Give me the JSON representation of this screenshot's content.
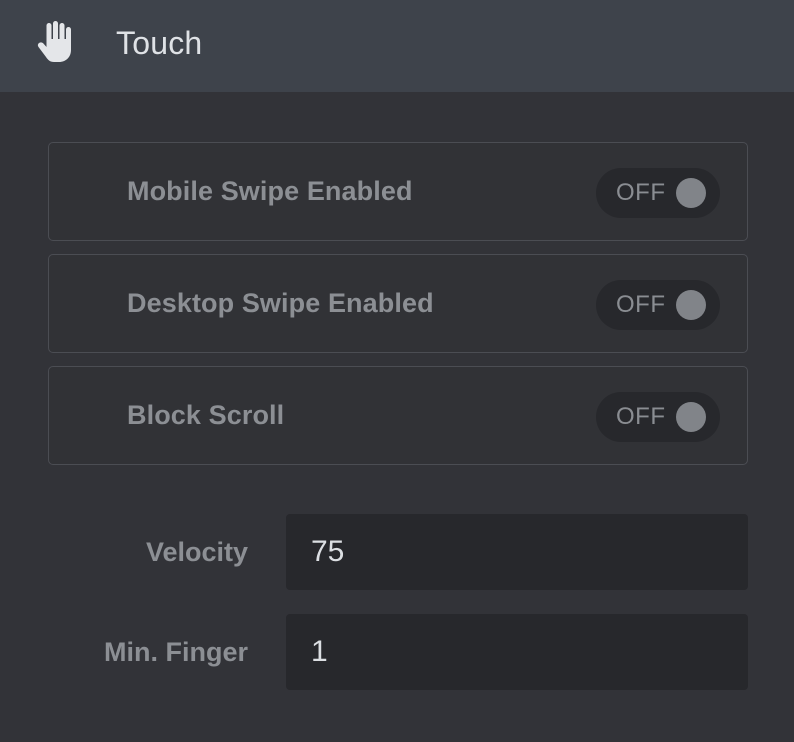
{
  "header": {
    "icon": "hand-icon",
    "title": "Touch"
  },
  "toggles": [
    {
      "label": "Mobile Swipe Enabled",
      "state": "OFF"
    },
    {
      "label": "Desktop Swipe Enabled",
      "state": "OFF"
    },
    {
      "label": "Block Scroll",
      "state": "OFF"
    }
  ],
  "fields": [
    {
      "label": "Velocity",
      "value": "75"
    },
    {
      "label": "Min. Finger",
      "value": "1"
    }
  ],
  "colors": {
    "background": "#323338",
    "header_background": "#3e434b",
    "input_background": "#27282c",
    "toggle_off_knob": "#818489"
  }
}
